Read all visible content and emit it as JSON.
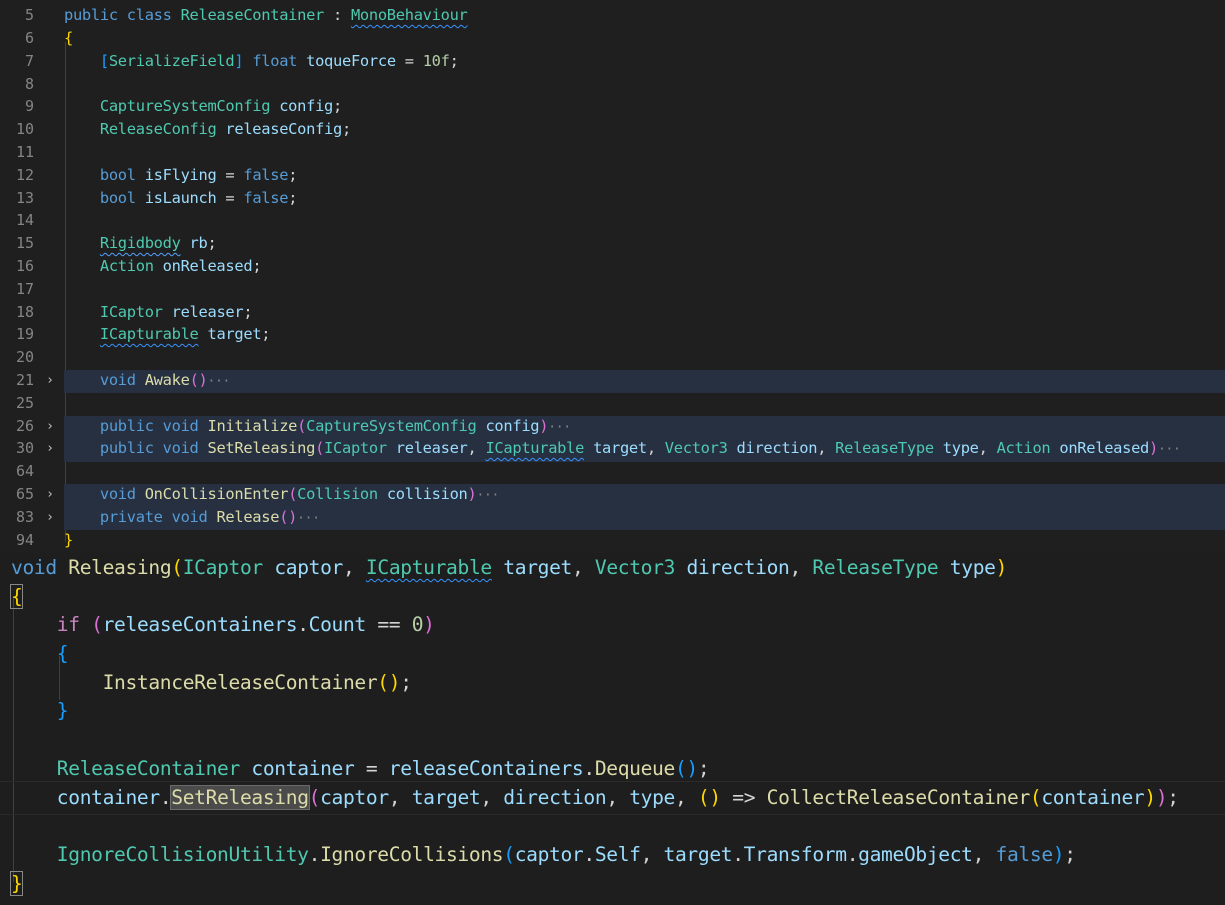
{
  "top_editor": {
    "lines": [
      {
        "n": "5",
        "text": "public class ReleaseContainer : MonoBehaviour"
      },
      {
        "n": "6",
        "text": "{"
      },
      {
        "n": "7",
        "text": "[SerializeField] float toqueForce = 10f;"
      },
      {
        "n": "8",
        "text": ""
      },
      {
        "n": "9",
        "text": "CaptureSystemConfig config;"
      },
      {
        "n": "10",
        "text": "ReleaseConfig releaseConfig;"
      },
      {
        "n": "11",
        "text": ""
      },
      {
        "n": "12",
        "text": "bool isFlying = false;"
      },
      {
        "n": "13",
        "text": "bool isLaunch = false;"
      },
      {
        "n": "14",
        "text": ""
      },
      {
        "n": "15",
        "text": "Rigidbody rb;"
      },
      {
        "n": "16",
        "text": "Action onReleased;"
      },
      {
        "n": "17",
        "text": ""
      },
      {
        "n": "18",
        "text": "ICaptor releaser;"
      },
      {
        "n": "19",
        "text": "ICapturable target;"
      },
      {
        "n": "20",
        "text": ""
      },
      {
        "n": "21",
        "text": "void Awake()"
      },
      {
        "n": "25",
        "text": ""
      },
      {
        "n": "26",
        "text": "public void Initialize(CaptureSystemConfig config)"
      },
      {
        "n": "30",
        "text": "public void SetReleasing(ICaptor releaser, ICapturable target, Vector3 direction, ReleaseType type, Action onReleased)"
      },
      {
        "n": "64",
        "text": ""
      },
      {
        "n": "65",
        "text": "void OnCollisionEnter(Collision collision)"
      },
      {
        "n": "83",
        "text": "private void Release()"
      },
      {
        "n": "94",
        "text": "}"
      }
    ],
    "fold_glyph": "›",
    "ellipsis": "···"
  },
  "bottom_editor": {
    "lines": [
      "void Releasing(ICaptor captor, ICapturable target, Vector3 direction, ReleaseType type)",
      "{",
      "if (releaseContainers.Count == 0)",
      "{",
      "InstanceReleaseContainer();",
      "}",
      "",
      "ReleaseContainer container = releaseContainers.Dequeue();",
      "container.SetReleasing(captor, target, direction, type, () => CollectReleaseContainer(container));",
      "",
      "IgnoreCollisionUtility.IgnoreCollisions(captor.Self, target.Transform.gameObject, false);",
      "}"
    ]
  },
  "colors": {
    "background": "#1e1e1e",
    "keyword": "#569cd6",
    "type": "#4ec9b0",
    "function": "#dcdcaa",
    "variable": "#9cdcfe",
    "number": "#b5cea8",
    "control": "#c586c0",
    "folded_line_highlight": "#263041",
    "squiggle": "#3794ff"
  }
}
